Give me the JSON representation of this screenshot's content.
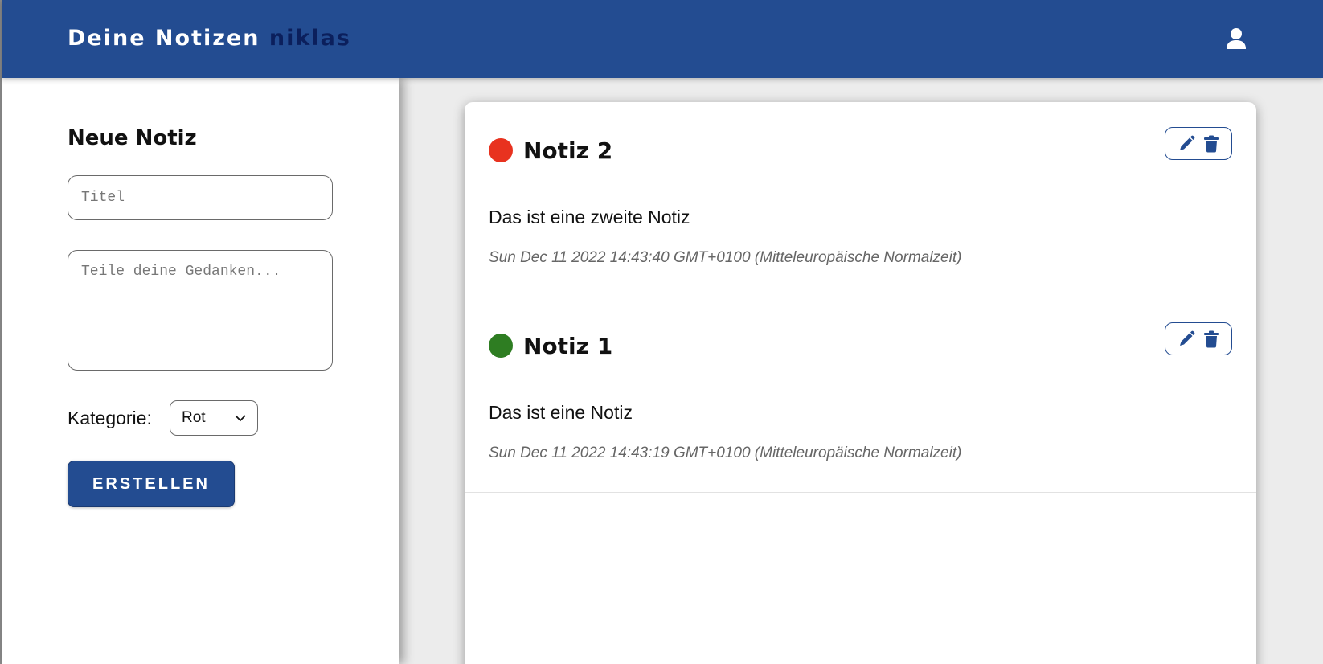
{
  "header": {
    "title": "Deine Notizen",
    "username": "niklas",
    "user_icon": "user-icon"
  },
  "form": {
    "heading": "Neue Notiz",
    "title_placeholder": "Titel",
    "content_placeholder": "Teile deine Gedanken...",
    "category_label": "Kategorie:",
    "category_selected": "Rot",
    "submit_label": "ERSTELLEN"
  },
  "notes": [
    {
      "title": "Notiz 2",
      "category_color": "#e8321f",
      "text": "Das ist eine zweite Notiz",
      "date": "Sun Dec 11 2022 14:43:40 GMT+0100 (Mitteleuropäische Normalzeit)"
    },
    {
      "title": "Notiz 1",
      "category_color": "#2e7d22",
      "text": "Das ist eine Notiz",
      "date": "Sun Dec 11 2022 14:43:19 GMT+0100 (Mitteleuropäische Normalzeit)"
    }
  ],
  "colors": {
    "primary": "#234c91",
    "username": "#0b1f5c"
  }
}
